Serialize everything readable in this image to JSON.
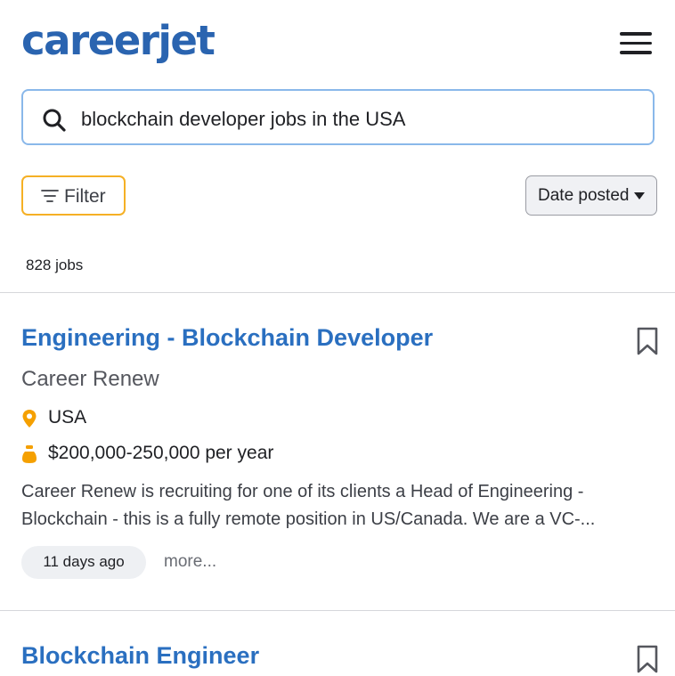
{
  "header": {
    "logo": "careerjet"
  },
  "search": {
    "query": "blockchain developer jobs in the USA"
  },
  "filters": {
    "filter_label": "Filter",
    "sort_label": "Date posted"
  },
  "results": {
    "count_label": "828 jobs"
  },
  "jobs": [
    {
      "title": "Engineering - Blockchain Developer",
      "company": "Career Renew",
      "location": "USA",
      "salary": "$200,000-250,000 per year",
      "description_line1": "Career Renew is recruiting for one of its clients a Head of Engineering -",
      "description_line2": "Blockchain - this is a fully remote position in US/Canada. We are a VC-...",
      "posted": "11 days ago",
      "more_label": "more..."
    },
    {
      "title": "Blockchain Engineer"
    }
  ],
  "colors": {
    "brand": "#2a64b0",
    "link": "#2a6fc0",
    "accent": "#f5a000",
    "filter_border": "#f5b025",
    "search_border": "#8ab8ea"
  }
}
